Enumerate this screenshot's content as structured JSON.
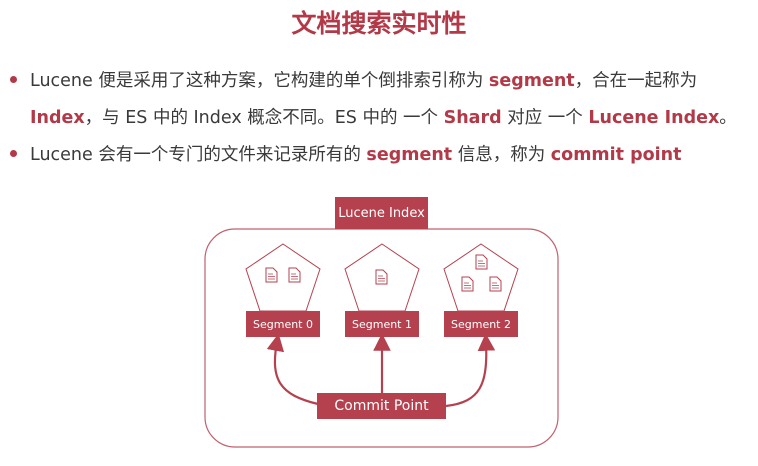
{
  "title": "文档搜索实时性",
  "bullets": [
    {
      "l1a": "Lucene 便是采用了这种方案，它构建的单个倒排索引称为 ",
      "l1b": "segment",
      "l1c": "，合在一起称为",
      "l2a": "Index",
      "l2b": "，与 ES 中的 Index 概念不同。ES 中的 一个 ",
      "l2c": "Shard",
      "l2d": " 对应 一个 ",
      "l2e": "Lucene Index",
      "l2f": "。"
    },
    {
      "a": "Lucene 会有一个专门的文件来记录所有的 ",
      "b": "segment",
      "c": " 信息，称为 ",
      "d": "commit point"
    }
  ],
  "diagram": {
    "index_label": "Lucene Index",
    "segments": [
      "Segment 0",
      "Segment 1",
      "Segment 2"
    ],
    "commit_label": "Commit Point",
    "accent": "#b5414f"
  }
}
